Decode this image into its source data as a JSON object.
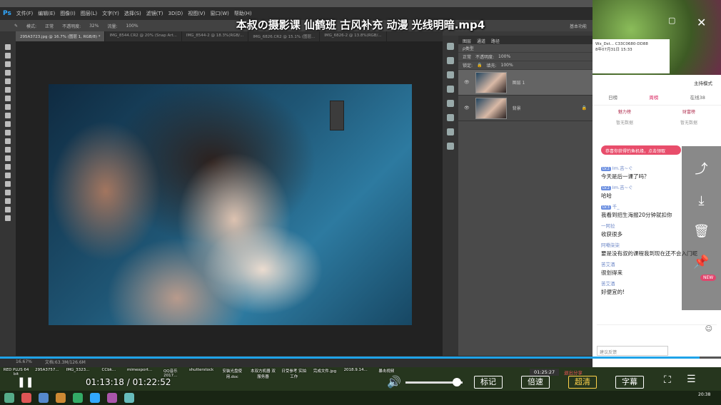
{
  "video_title": "本叔の摄影课 仙鹤班 古风补充 动漫 光线明暗.mp4",
  "photoshop": {
    "menu": [
      "文件(F)",
      "编辑(E)",
      "图像(I)",
      "图层(L)",
      "文字(Y)",
      "选择(S)",
      "滤镜(T)",
      "3D(D)",
      "视图(V)",
      "窗口(W)",
      "帮助(H)"
    ],
    "options": {
      "mode_label": "模式:",
      "mode_value": "正常",
      "opacity_label": "不透明度:",
      "opacity_value": "32%",
      "flow_label": "流量:",
      "flow_value": "100%",
      "workspace": "基本功能"
    },
    "tabs": [
      {
        "label": "295A3723.jpg @ 16.7% (图层 1, RGB/8) *",
        "active": true
      },
      {
        "label": "IMG_8544.CR2 @ 20% (Snap Art...",
        "active": false
      },
      {
        "label": "IMG_8544-2 @ 18.3%(RGB/...",
        "active": false
      },
      {
        "label": "IMG_6826.CR2 @ 15.1% (图层...",
        "active": false
      },
      {
        "label": "IMG_6826-2 @ 13.8%(RGB/...",
        "active": false
      }
    ],
    "status": {
      "zoom": "16.67%",
      "doc": "文档:63.3M/126.6M"
    },
    "layers_panel": {
      "tabs": [
        "图层",
        "通道",
        "路径"
      ],
      "filter": "ρ类型",
      "blend": "正常",
      "opacity_label": "不透明度:",
      "opacity": "100%",
      "lock_label": "锁定:",
      "fill_label": "填充:",
      "fill": "100%",
      "layers": [
        {
          "name": "图层 1",
          "selected": true
        },
        {
          "name": "背景",
          "selected": false
        }
      ]
    }
  },
  "browser_snippet": {
    "line1": "Wx_Dst... C33C0680-DD88",
    "line2": "8年07月31日 15:33"
  },
  "chat": {
    "header": "主持模式",
    "tabs": [
      {
        "label": "日榜",
        "active": false
      },
      {
        "label": "周榜",
        "active": true
      },
      {
        "label": "在线38",
        "active": false
      }
    ],
    "columns": [
      {
        "title": "魅力榜",
        "sub": "暂无数据"
      },
      {
        "title": "财富榜",
        "sub": "暂无数据"
      }
    ],
    "promo": "恭喜你获得钓鱼机缘，点击领取",
    "messages": [
      {
        "level": "LV.2",
        "user": "Im.吉~ぐ",
        "text": "今天是后一课了吗？"
      },
      {
        "level": "LV.2",
        "user": "Im.吉~ぐ",
        "text": "哈哈"
      },
      {
        "level": "LV.3",
        "user": "千_",
        "text": "我看到招生海报20分钟就扣你"
      },
      {
        "level": "",
        "user": "一阿拉",
        "text": "收获很多"
      },
      {
        "level": "",
        "user": "阿嘞柒柒",
        "text": "要是没有叔的课程我到现在还不会入门呢"
      },
      {
        "level": "",
        "user": "苦艾酒",
        "text": "很划得来"
      },
      {
        "level": "",
        "user": "苦艾酒",
        "text": "好便宜的!"
      }
    ],
    "new_badge": "NEW",
    "suggest": "建议反馈"
  },
  "player": {
    "time": "01:13:18 / 01:22:52",
    "progress": 0.97,
    "volume": 0.9,
    "buttons": [
      "标记",
      "倍速",
      "超清",
      "字幕"
    ],
    "rec_time": "01:25:27",
    "exit_share": "退出分享"
  },
  "desktop_icons": [
    "RED PLUS 64 bit",
    "295A3757...",
    "IMG_3323...",
    "CCbk...",
    "mimexport...",
    "QQ音乐 2017...",
    "shutterstock",
    "安装光盘使用.doc",
    "本双方机器 双服务器",
    "日受参考 实拍工作",
    "完成文件.jpg",
    "2018.9.14...",
    "暴击视频"
  ],
  "clock": {
    "time": "20:38",
    "date": "2018/9/13"
  }
}
